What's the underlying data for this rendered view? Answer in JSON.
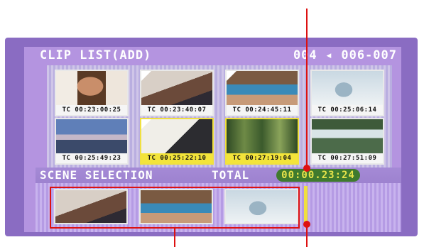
{
  "header": {
    "title": "CLIP LIST(ADD)",
    "clip_range": "004 ◂ 006-007"
  },
  "clips": [
    {
      "timecode": "TC 00:23:00:25",
      "selected": false,
      "marked": false,
      "scene": "woman-portrait"
    },
    {
      "timecode": "TC 00:23:40:07",
      "selected": false,
      "marked": true,
      "scene": "drawing-on-paper"
    },
    {
      "timecode": "TC 00:24:45:11",
      "selected": false,
      "marked": true,
      "scene": "poolside"
    },
    {
      "timecode": "TC 00:25:06:14",
      "selected": false,
      "marked": false,
      "scene": "feet-on-sand"
    },
    {
      "timecode": "TC 00:25:49:23",
      "selected": false,
      "marked": false,
      "scene": "sky-landscape"
    },
    {
      "timecode": "TC 00:25:22:10",
      "selected": true,
      "marked": true,
      "scene": "paper-closeup"
    },
    {
      "timecode": "TC 00:27:19:04",
      "selected": true,
      "marked": false,
      "scene": "forest"
    },
    {
      "timecode": "TC 00:27:51:09",
      "selected": false,
      "marked": false,
      "scene": "waterfall"
    }
  ],
  "scene_selection": {
    "label": "SCENE SELECTION",
    "total_label": "TOTAL",
    "total_value": "00:00.23:24",
    "selected_scenes": [
      "drawing-on-paper",
      "poolside",
      "feet-on-sand"
    ]
  },
  "colors": {
    "accent": "#f0e040",
    "annotation": "#d11111",
    "total_bg": "#3f7a2e"
  }
}
